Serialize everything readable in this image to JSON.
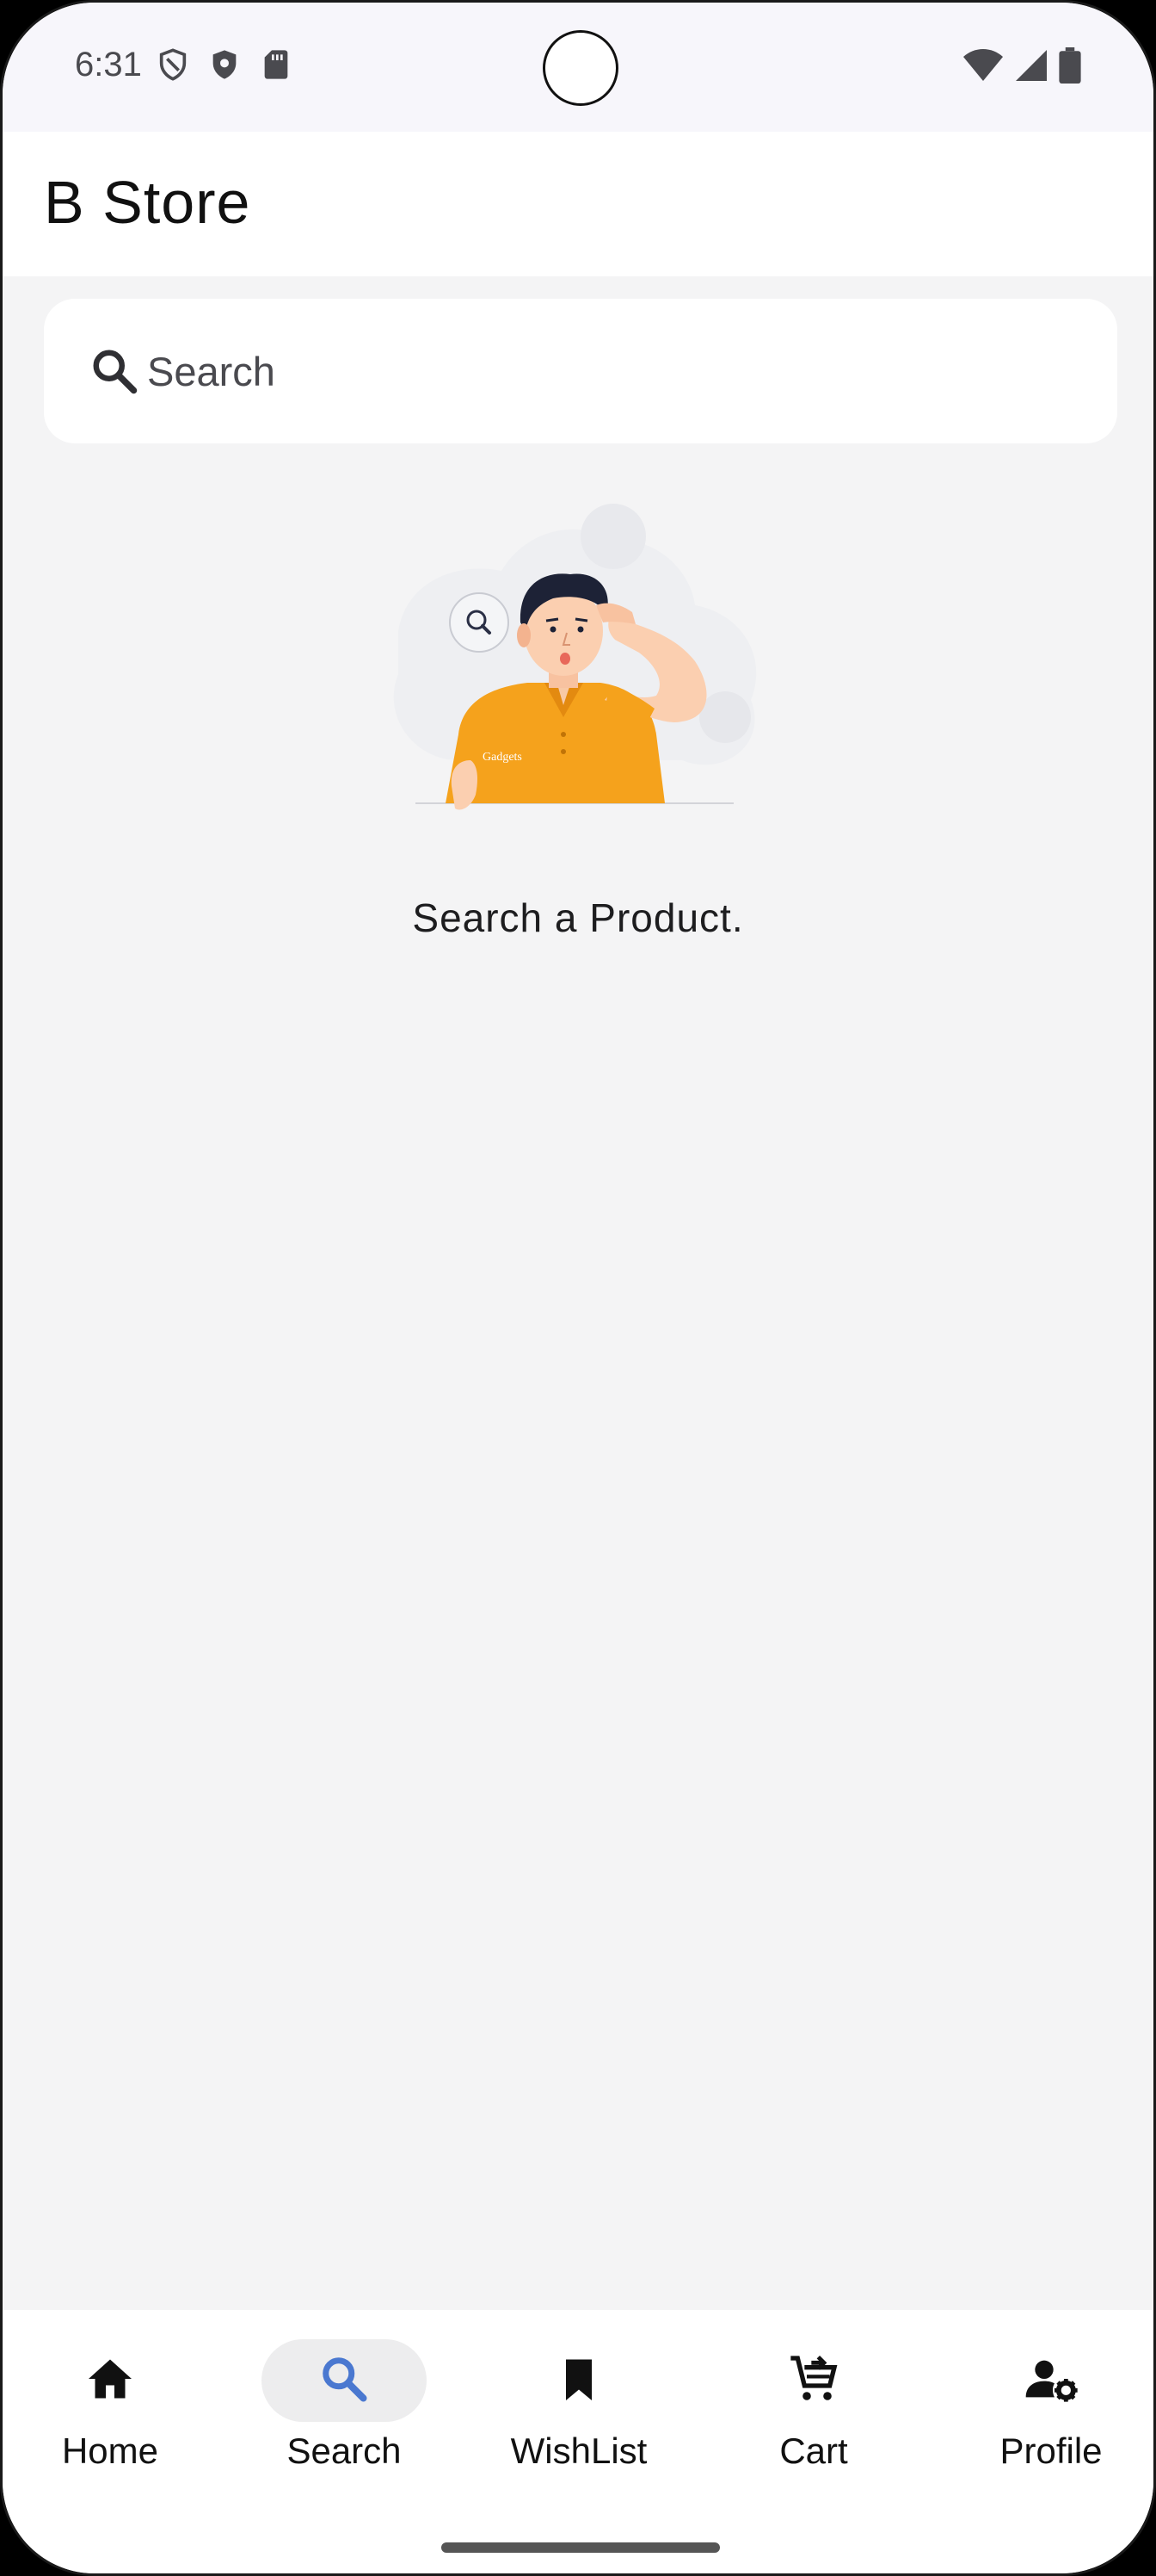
{
  "status_bar": {
    "time": "6:31",
    "left_icons": [
      "vpn-shield-icon",
      "shield-icon",
      "sd-card-icon"
    ],
    "right_icons": [
      "wifi-icon",
      "signal-icon",
      "battery-icon"
    ]
  },
  "app_bar": {
    "title": "B Store"
  },
  "search": {
    "placeholder": "Search",
    "icon": "search-icon"
  },
  "empty_state": {
    "illustration": "person-searching-illustration",
    "message": "Search a Product."
  },
  "bottom_nav": {
    "active": "Search",
    "accent_color": "#4a78d0",
    "items": [
      {
        "label": "Home",
        "icon": "home-icon"
      },
      {
        "label": "Search",
        "icon": "search-icon"
      },
      {
        "label": "WishList",
        "icon": "bookmark-icon"
      },
      {
        "label": "Cart",
        "icon": "cart-icon"
      },
      {
        "label": "Profile",
        "icon": "profile-settings-icon"
      }
    ]
  }
}
